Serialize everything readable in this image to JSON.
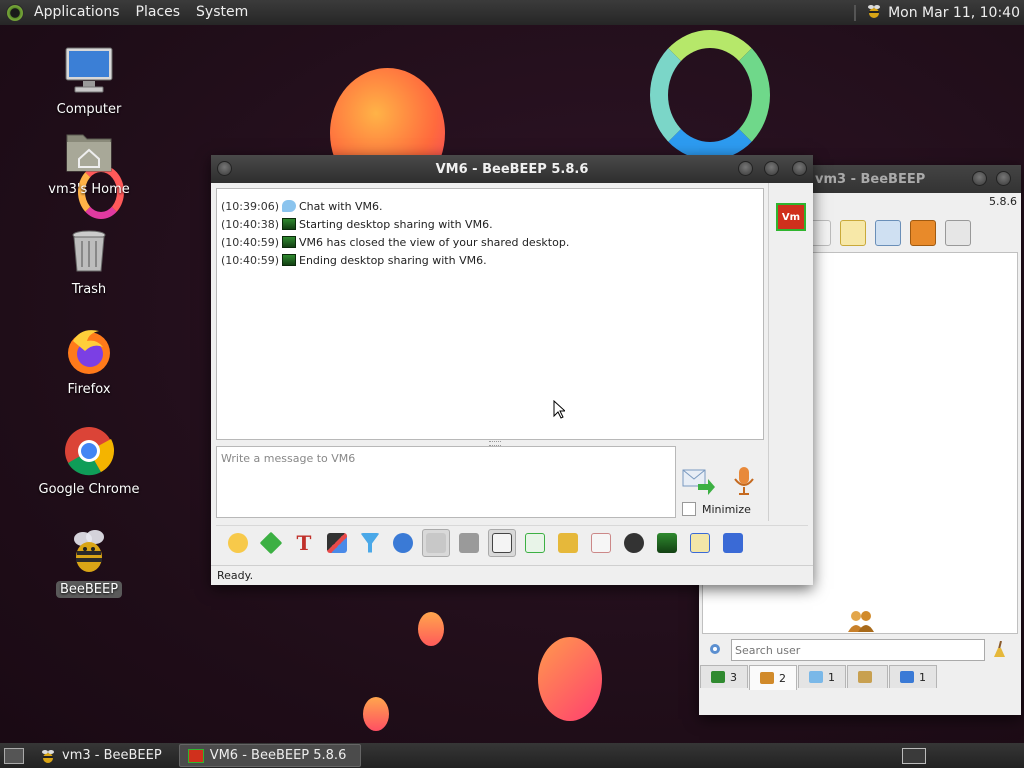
{
  "top_panel": {
    "menus": [
      "Applications",
      "Places",
      "System"
    ],
    "clock": "Mon Mar 11, 10:40"
  },
  "desktop_icons": [
    {
      "label": "Computer"
    },
    {
      "label": "vm3's Home"
    },
    {
      "label": "Trash"
    },
    {
      "label": "Firefox"
    },
    {
      "label": "Google Chrome"
    },
    {
      "label": "BeeBEEP"
    }
  ],
  "chat_window": {
    "title": "VM6 - BeeBEEP 5.8.6",
    "avatar_label": "Vm",
    "messages": [
      {
        "time": "(10:39:06)",
        "icon": "chat-bubble-icon",
        "text": "Chat with VM6."
      },
      {
        "time": "(10:40:38)",
        "icon": "screen-share-icon",
        "text": "Starting desktop sharing with VM6."
      },
      {
        "time": "(10:40:59)",
        "icon": "screen-share-icon",
        "text": "VM6 has closed the view of your shared desktop."
      },
      {
        "time": "(10:40:59)",
        "icon": "screen-share-icon",
        "text": "Ending desktop sharing with VM6."
      }
    ],
    "input_placeholder": "Write a message to VM6",
    "minimize_label": "Minimize",
    "status": "Ready."
  },
  "main_window": {
    "title": "vm3 - BeeBEEP",
    "version": "5.8.6",
    "search_placeholder": "Search user",
    "tabs": [
      {
        "count": "3",
        "icon": "screen-icon"
      },
      {
        "count": "2",
        "icon": "users-icon"
      },
      {
        "count": "1",
        "icon": "chats-icon"
      },
      {
        "count": "",
        "icon": "groups-icon"
      },
      {
        "count": "1",
        "icon": "files-icon"
      }
    ]
  },
  "taskbar": {
    "tasks": [
      {
        "label": "vm3 - BeeBEEP",
        "active": false
      },
      {
        "label": "VM6 - BeeBEEP 5.8.6",
        "active": true
      }
    ]
  }
}
